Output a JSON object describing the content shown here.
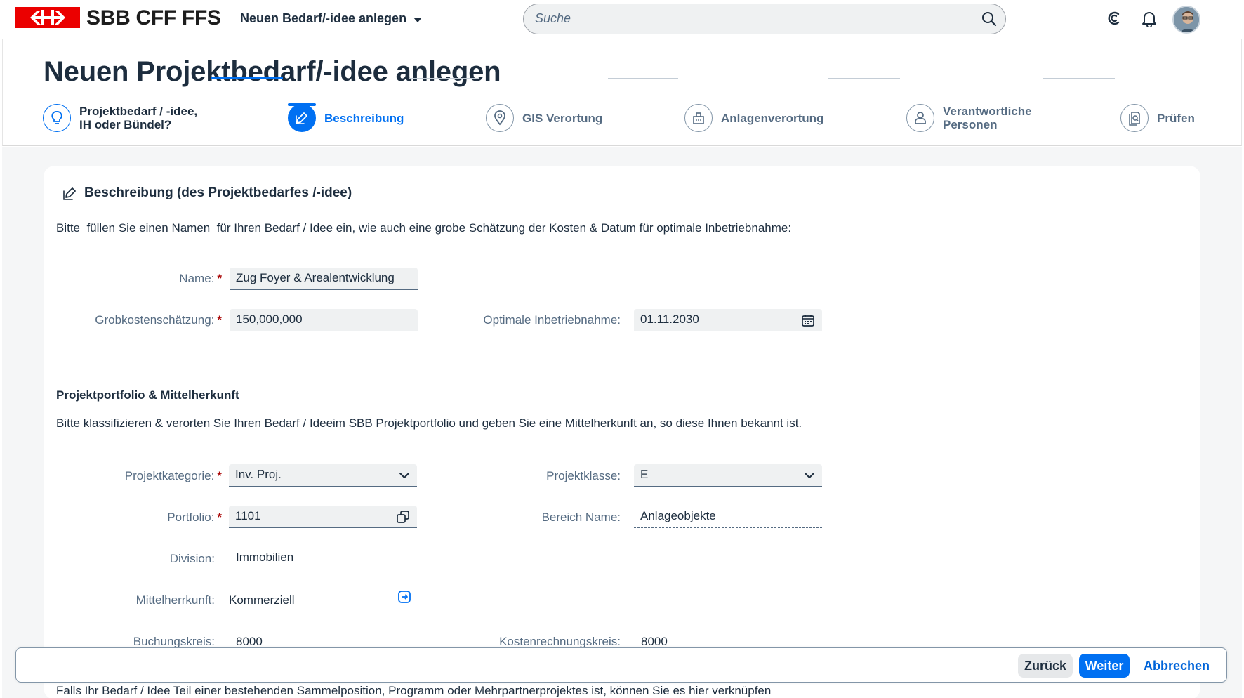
{
  "shell": {
    "brand": "SBB CFF FFS",
    "app_title": "Neuen Bedarf/-idee anlegen",
    "search_placeholder": "Suche"
  },
  "page": {
    "title": "Neuen Projektbedarf/-idee anlegen"
  },
  "wizard": {
    "steps": [
      {
        "line1": "Projektbedarf / -idee,",
        "line2": "IH oder Bündel?",
        "icon": "lightbulb-icon",
        "state": "completed"
      },
      {
        "line1": "Beschreibung",
        "line2": "",
        "icon": "edit-icon",
        "state": "active"
      },
      {
        "line1": "GIS Verortung",
        "line2": "",
        "icon": "location-icon",
        "state": "inactive"
      },
      {
        "line1": "Anlagenverortung",
        "line2": "",
        "icon": "building-icon",
        "state": "inactive"
      },
      {
        "line1": "Verantwortliche",
        "line2": "Personen",
        "icon": "person-icon",
        "state": "inactive"
      },
      {
        "line1": "Prüfen",
        "line2": "",
        "icon": "review-icon",
        "state": "inactive"
      }
    ]
  },
  "section": {
    "title": "Beschreibung (des Projektbedarfes /-idee)",
    "intro": "Bitte  füllen Sie einen Namen  für Ihren Bedarf / Idee ein, wie auch eine grobe Schätzung der Kosten & Datum für optimale Inbetriebnahme:"
  },
  "form1": {
    "name_label": "Name:",
    "name_value": "Zug Foyer & Arealentwicklung",
    "cost_label": "Grobkostenschätzung:",
    "cost_value": "150,000,000",
    "date_label": "Optimale Inbetriebnahme:",
    "date_value": "01.11.2030"
  },
  "portfolio": {
    "heading": "Projektportfolio & Mittelherkunft",
    "intro": "Bitte klassifizieren & verorten Sie Ihren Bedarf / Ideeim SBB Projektportfolio und geben Sie eine Mittelherkunft an, so diese Ihnen bekannt ist.",
    "category_label": "Projektkategorie:",
    "category_value": "Inv. Proj.",
    "class_label": "Projektklasse:",
    "class_value": "E",
    "portfolio_label": "Portfolio:",
    "portfolio_value": "1101",
    "area_label": "Bereich Name:",
    "area_value": "Anlageobjekte",
    "division_label": "Division:",
    "division_value": "Immobilien",
    "source_label": "Mittelherrkunft:",
    "source_value": "Kommerziell",
    "booking_label": "Buchungskreis:",
    "booking_value": "8000",
    "costcenter_label": "Kostenrechnungskreis:",
    "costcenter_value": "8000",
    "cut_text": "Falls Ihr Bedarf / Idee Teil einer bestehenden Sammelposition, Programm oder Mehrpartnerprojektes ist, können Sie es hier verknüpfen"
  },
  "footer": {
    "back": "Zurück",
    "next": "Weiter",
    "cancel": "Abbrechen"
  },
  "colors": {
    "brand_red": "#eb0000",
    "accent_blue": "#0070f2",
    "required_red": "#aa0808"
  }
}
